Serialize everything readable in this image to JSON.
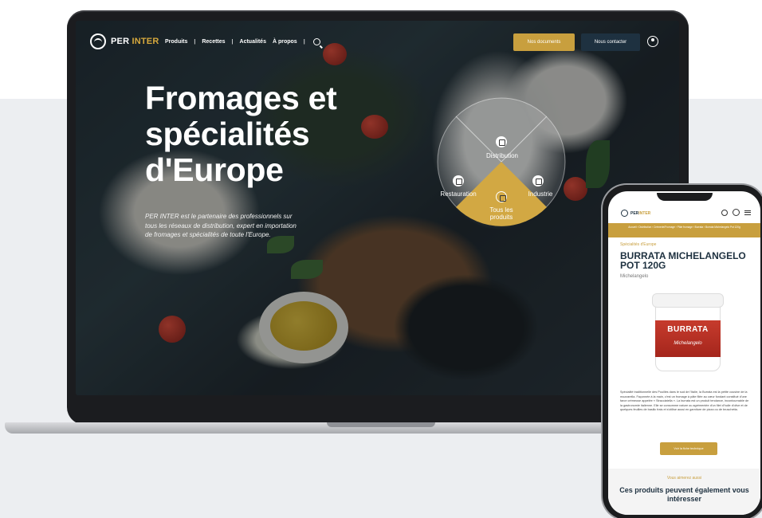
{
  "laptop": {
    "nav": {
      "logo_text_a": "PER",
      "logo_text_b": "INTER",
      "links": [
        "Produits",
        "Recettes",
        "Actualités",
        "À propos"
      ],
      "sep": "|",
      "btn_docs": "Nos documents",
      "btn_contact": "Nous contacter"
    },
    "hero": {
      "title_line1": "Fromages et",
      "title_line2": "spécialités",
      "title_line3": "d'Europe",
      "description": "PER INTER est le partenaire des professionnels sur tous les réseaux de distribution, expert en importation de fromages et spécialités de toute l'Europe."
    },
    "wheel": {
      "distribution": "Distribution",
      "restauration": "Restauration",
      "industrie": "Industrie",
      "tous_line1": "Tous les",
      "tous_line2": "produits"
    }
  },
  "phone": {
    "logo_text_a": "PER",
    "logo_text_b": "INTER",
    "breadcrumb": "Accueil › Distribution › Crèmerie/Fromage › Pâte fromage › Burrata › Burrata Michelangelo Pot 120g",
    "category": "Spécialités d'Europe",
    "title": "BURRATA MICHELANGELO POT 120G",
    "brand": "Michelangelo",
    "jar_text": "BURRATA",
    "jar_script": "Michelangelo",
    "description": "Spécialité traditionnelle des Pouilles dans le sud de l'Italie, la Burrata est la petite cousine de la mozzarella. Façonnée à la main, c'est un fromage à pâte filée au cœur fondant constitué d'une farce crémeuse appelée « Stracciatella ». La burrata est un produit tendance, incontournable de la gastronomie italienne. Elle se consomme nature ou agrémentée d'un filet d'huile d'olive et de quelques feuilles de basilic frais et s'utilise aussi en garniture de pizza ou de bruschetta.",
    "btn_label": "Voir la fiche technique",
    "suggest_label": "Vous aimerez aussi",
    "suggest_title": "Ces produits peuvent également vous intéresser"
  },
  "colors": {
    "gold": "#c89f3e",
    "navy": "#1e3140",
    "red": "#c63b2d"
  }
}
